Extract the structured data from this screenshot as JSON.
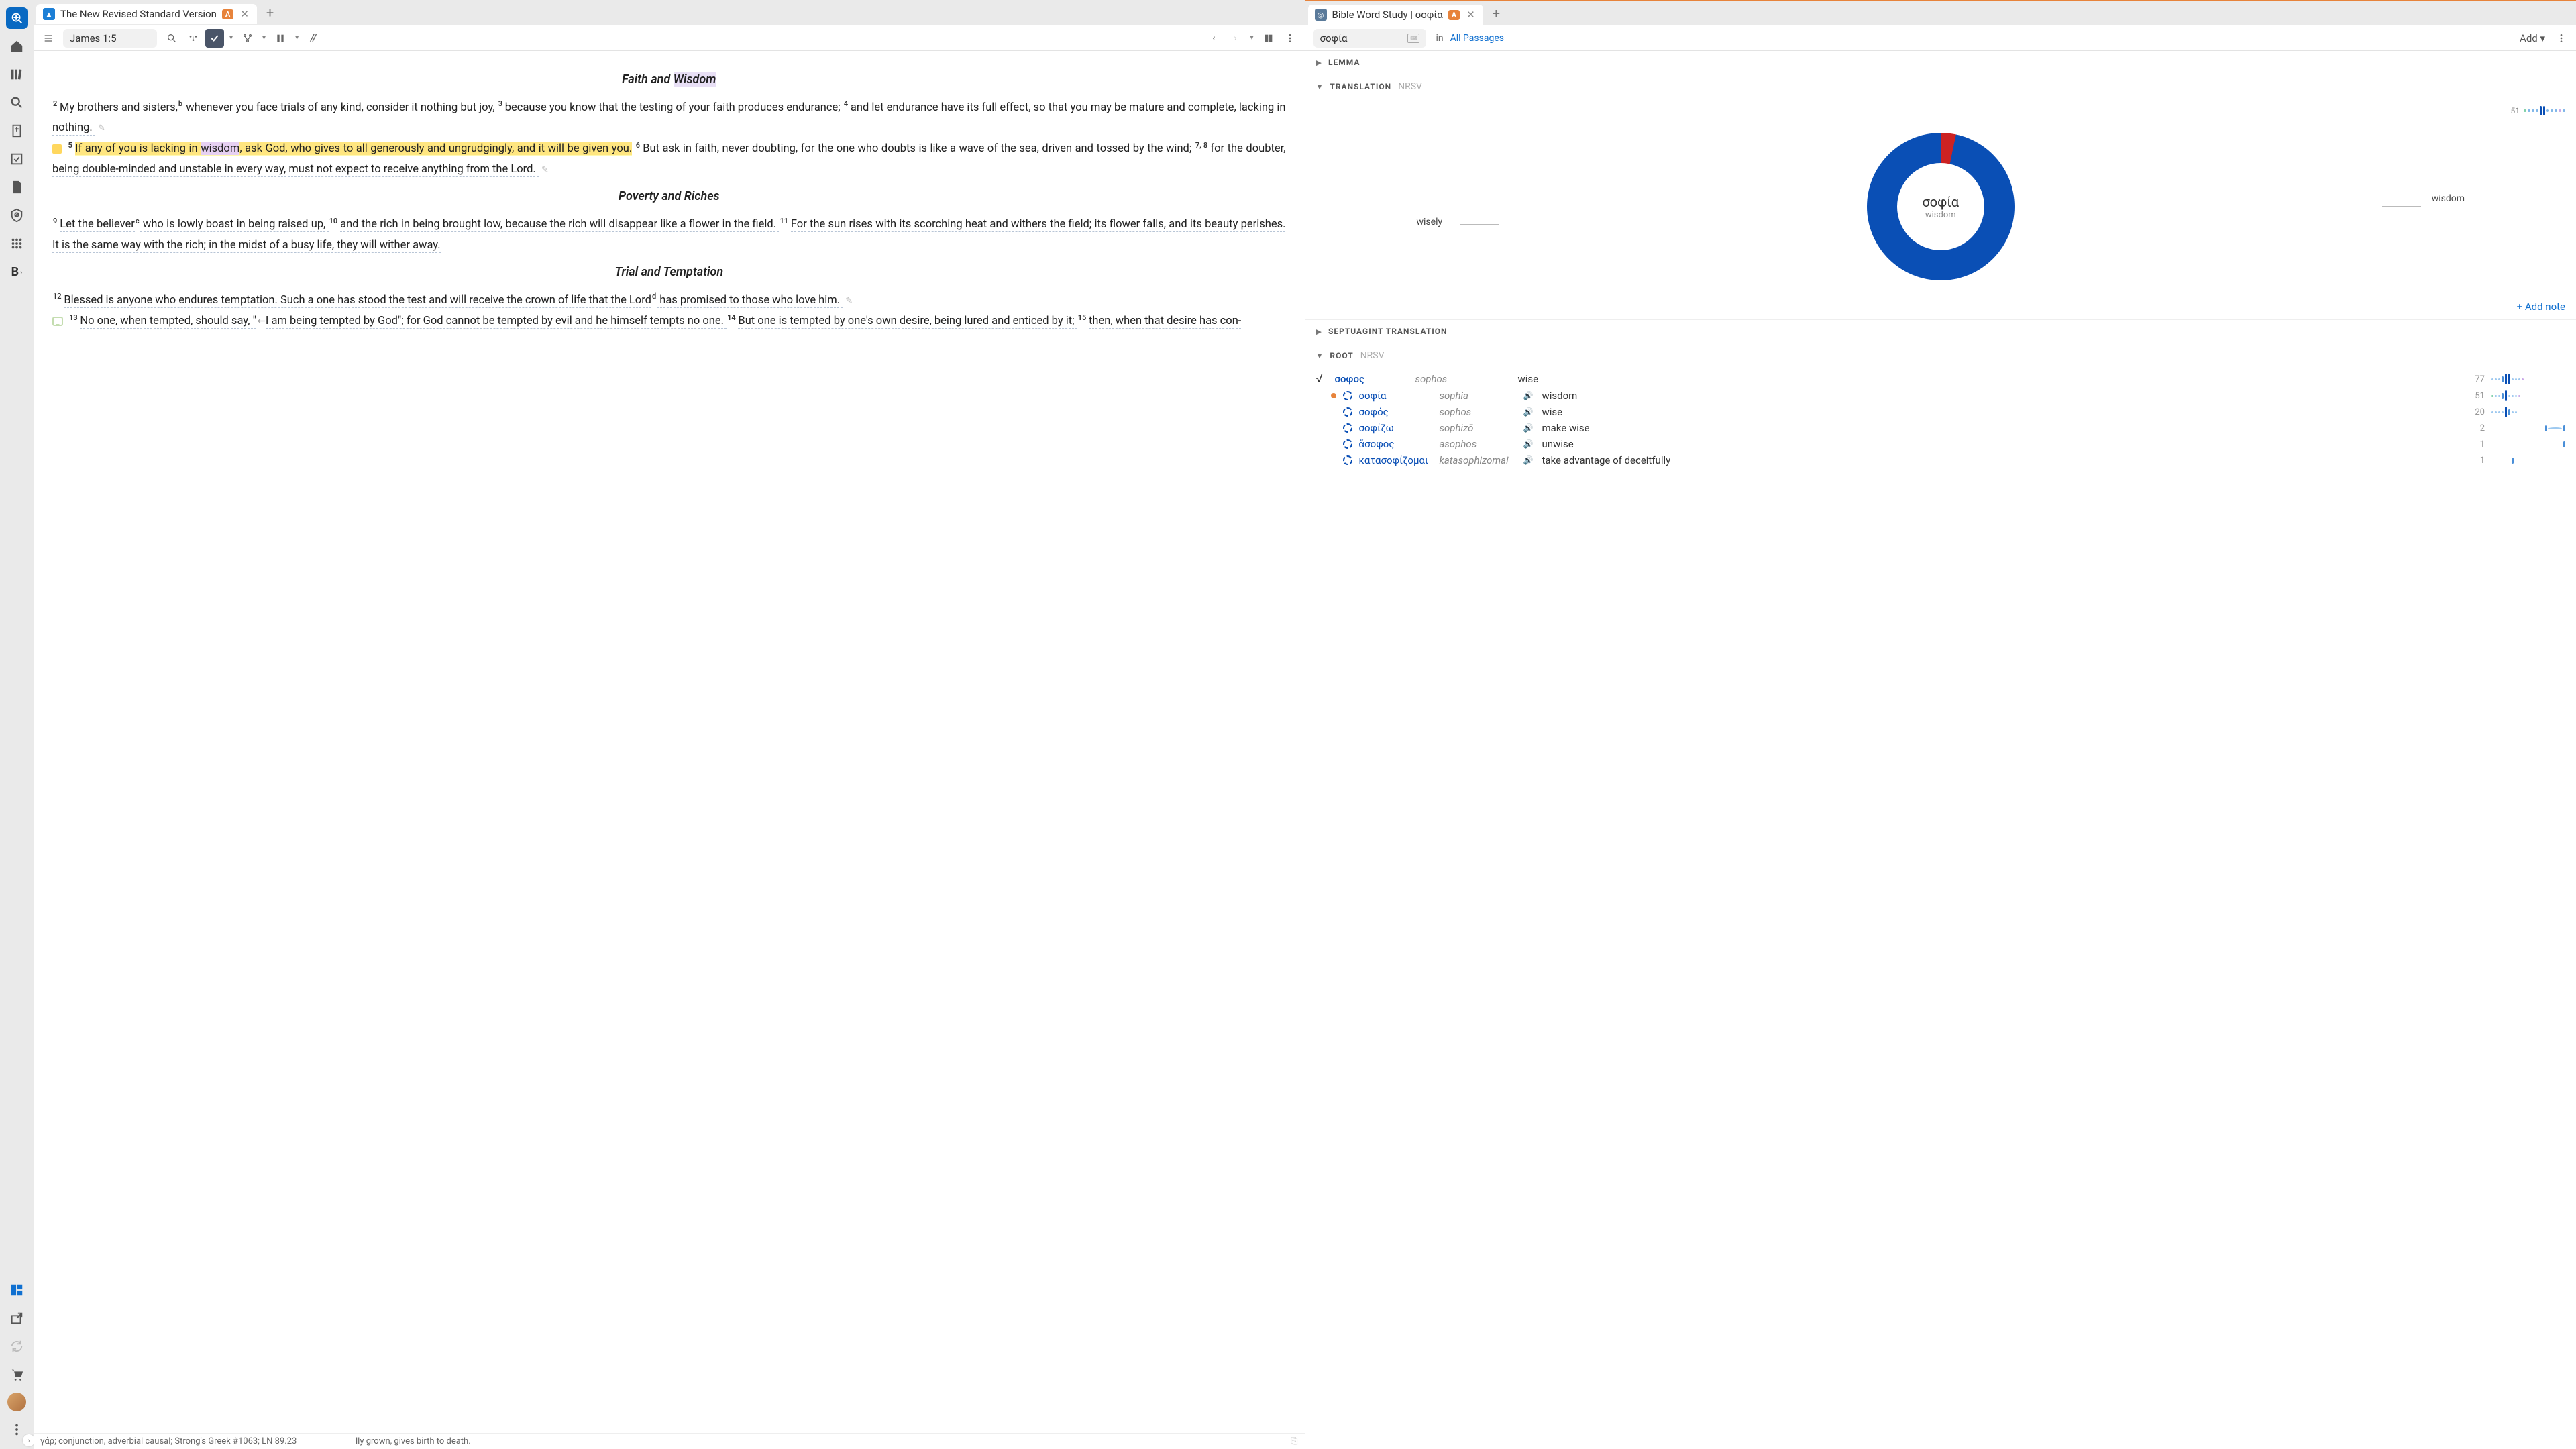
{
  "sidebar": {
    "items": [
      "app-logo",
      "home",
      "library",
      "search",
      "reference",
      "tasks",
      "document",
      "blocked",
      "apps"
    ],
    "bold_label": "B"
  },
  "left": {
    "tab": {
      "title": "The New Revised Standard Version",
      "badge": "A"
    },
    "reference": "James 1:5",
    "headings": {
      "h1": "Faith and Wisdom",
      "h2": "Poverty and Riches",
      "h3": "Trial and Temptation"
    },
    "verses": {
      "v2a": "My brothers and sisters,",
      "v2b": " whenever you face trials of any kind, consider it nothing but joy, ",
      "v3": "because you know that the testing of your faith produces endurance; ",
      "v4": "and let endurance have its full effect, so that you may be mature and complete, lacking in nothing. ",
      "v5": "If any of you is lacking in wisdom, ask God, who gives to all generously and ungrudgingly, and it will be given you. ",
      "v6": "But ask in faith, never doubting, for the one who doubts is like a wave of the sea, driven and tossed by the wind; ",
      "v78": "for the doubter, being double-minded and unstable in every way, must not expect to receive anything from the Lord. ",
      "v9": "Let the believer",
      "v9b": " who is lowly boast in being raised up, ",
      "v10": "and the rich in being brought low, because the rich will disappear like a flower in the field. ",
      "v11": "For the sun rises with its scorching heat and withers the field; its flower falls, and its beauty perishes. It is the same way with the rich; in the midst of a busy life, they will wither away.",
      "v12": "Blessed is anyone who endures temptation. Such a one has stood the test and will receive the crown of life that the Lord",
      "v12b": " has promised to those who love him. ",
      "v13a": "No one, when tempted, should say, \"",
      "v13b": "I am being tempted by God\"; for God cannot be tempted by evil and he himself tempts no one. ",
      "v14": "But one is tempted by one's own desire, being lured and enticed by it; ",
      "v15": "then, when that desire has con-",
      "v15b": "lly grown, gives birth to death."
    },
    "footer": "γάρ; conjunction, adverbial causal; Strong's Greek #1063; LN 89.23"
  },
  "right": {
    "tab": {
      "title": "Bible Word Study | σοφία",
      "badge": "A"
    },
    "search": "σοφία",
    "in_label": "in",
    "passages": "All Passages",
    "add_label": "Add",
    "sections": {
      "lemma": "LEMMA",
      "translation": "TRANSLATION",
      "translation_sub": "NRSV",
      "septuagint": "SEPTUAGINT TRANSLATION",
      "root": "ROOT",
      "root_sub": "NRSV"
    },
    "donut": {
      "greek": "σοφία",
      "english": "wisdom",
      "label_left": "wisely",
      "label_right": "wisdom",
      "count": "51"
    },
    "add_note": "+ Add note",
    "chart_data": {
      "type": "pie",
      "title": "σοφία — NRSV translation distribution",
      "series": [
        {
          "name": "wisdom",
          "value": 49,
          "color": "#0a4fb5"
        },
        {
          "name": "wisely",
          "value": 2,
          "color": "#c22"
        }
      ],
      "total": 51
    },
    "roots": [
      {
        "greek": "σοφος",
        "tr": "sophos",
        "en": "wise",
        "count": "77",
        "top": true
      },
      {
        "greek": "σοφία",
        "tr": "sophia",
        "en": "wisdom",
        "count": "51",
        "active": true
      },
      {
        "greek": "σοφός",
        "tr": "sophos",
        "en": "wise",
        "count": "20"
      },
      {
        "greek": "σοφίζω",
        "tr": "sophizō",
        "en": "make wise",
        "count": "2"
      },
      {
        "greek": "ἄσοφος",
        "tr": "asophos",
        "en": "unwise",
        "count": "1"
      },
      {
        "greek": "κατασοφίζομαι",
        "tr": "katasophizomai",
        "en": "take advantage of deceitfully",
        "count": "1"
      }
    ]
  }
}
